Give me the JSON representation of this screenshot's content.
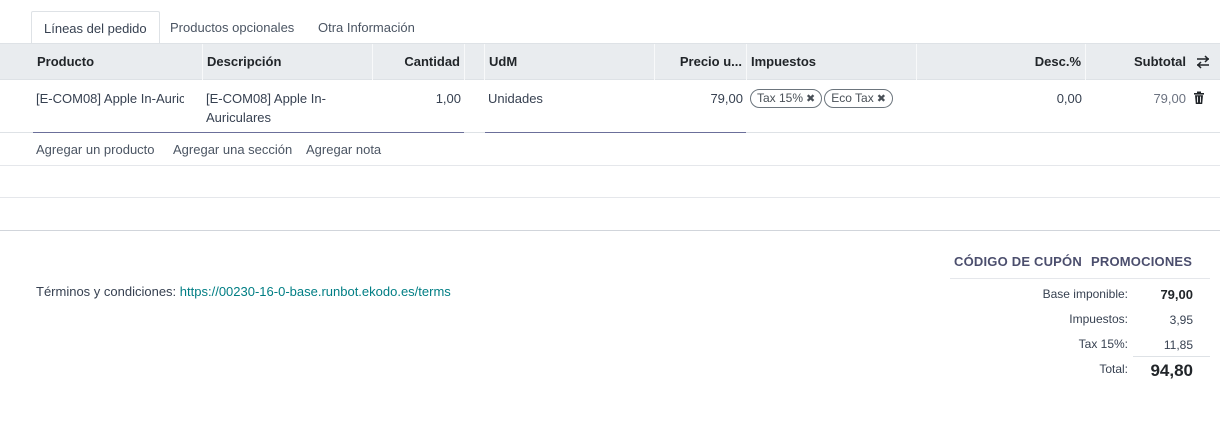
{
  "tabs": [
    {
      "label": "Líneas del pedido",
      "active": true
    },
    {
      "label": "Productos opcionales",
      "active": false
    },
    {
      "label": "Otra Información",
      "active": false
    }
  ],
  "table": {
    "headers": {
      "product": "Producto",
      "description": "Descripción",
      "quantity": "Cantidad",
      "uom": "UdM",
      "price": "Precio u...",
      "taxes": "Impuestos",
      "discount": "Desc.%",
      "subtotal": "Subtotal"
    },
    "rows": [
      {
        "product": "[E-COM08] Apple In-Auric",
        "description_line1": "[E-COM08] Apple In-",
        "description_line2": "Auriculares",
        "quantity": "1,00",
        "uom": "Unidades",
        "price": "79,00",
        "taxes": [
          "Tax 15%",
          "Eco Tax"
        ],
        "discount": "0,00",
        "subtotal": "79,00"
      }
    ],
    "add_actions": {
      "add_product": "Agregar un producto",
      "add_section": "Agregar una sección",
      "add_note": "Agregar nota"
    }
  },
  "footer": {
    "coupon_button": "CÓDIGO DE CUPÓN",
    "promotions_button": "PROMOCIONES",
    "terms_label": "Términos y condiciones:",
    "terms_link": "https://00230-16-0-base.runbot.ekodo.es/terms",
    "totals": {
      "base_label": "Base imponible:",
      "base_value": "79,00",
      "taxes_label": "Impuestos:",
      "taxes_value": "3,95",
      "tax15_label": "Tax 15%:",
      "tax15_value": "11,85",
      "total_label": "Total:",
      "total_value": "94,80"
    }
  },
  "colors": {
    "header_bg": "#e9ecef",
    "link": "#017e84",
    "accent": "#4b4e6d"
  },
  "icons": {
    "column_settings": "sliders-icon",
    "delete": "trash-icon",
    "remove_tag": "close-icon"
  }
}
